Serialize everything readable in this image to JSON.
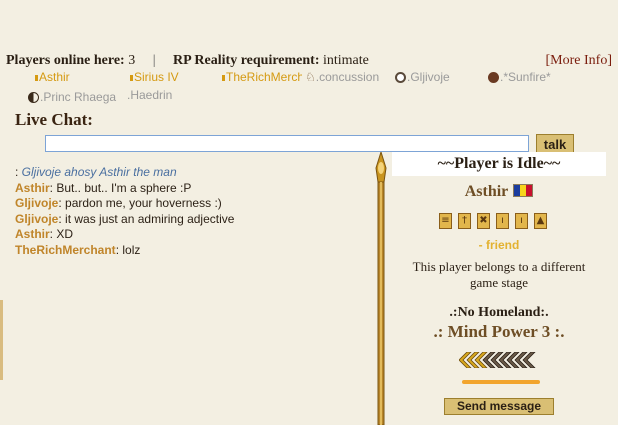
{
  "header": {
    "players_online_label": "Players online here:",
    "players_online_count": "3",
    "separator": "|",
    "rp_label": "RP Reality requirement:",
    "rp_value": "intimate",
    "more_info": "[More Info]"
  },
  "online_users": [
    {
      "name": "Asthir",
      "color": "#d59a12"
    },
    {
      "name": "Sirius IV",
      "color": "#d59a12"
    },
    {
      "name": "TheRichMerch",
      "color": "#d59a12"
    },
    {
      "name": ".concussion",
      "color": "#9a9a9a"
    },
    {
      "name": ".Gljivoje",
      "color": "#9a9a9a"
    },
    {
      "name": ".*Sunfire*",
      "color": "#9a9a9a"
    },
    {
      "name": ".Princ Rhaega",
      "color": "#9a9a9a"
    },
    {
      "name": ".Haedrin",
      "color": "#9a9a9a"
    }
  ],
  "live_chat": {
    "title": "Live Chat:",
    "input_value": "",
    "talk_label": "talk",
    "messages": [
      {
        "prefix": ": ",
        "emote": "Gljivoje ahosy Asthir the man"
      },
      {
        "name": "Asthir",
        "text": ": But.. but.. I'm a sphere :P"
      },
      {
        "name": "Gljivoje",
        "text": ": pardon me, your hoverness :)"
      },
      {
        "name": "Gljivoje",
        "text": ": it was just an admiring adjective"
      },
      {
        "name": "Asthir",
        "text": ": XD"
      },
      {
        "name": "TheRichMerchant",
        "text": ": lolz"
      }
    ]
  },
  "player_panel": {
    "title": "~~Player is Idle~~",
    "player_name": "Asthir",
    "badges": [
      "≡",
      "†",
      "✖",
      "ı",
      "ı",
      "▲"
    ],
    "relation": "- friend",
    "belongs_line1": "This player belongs to a different",
    "belongs_line2": "game stage",
    "homeland": ".:No Homeland:.",
    "mind_power": ".: Mind Power 3 :.",
    "send_message": "Send message"
  }
}
